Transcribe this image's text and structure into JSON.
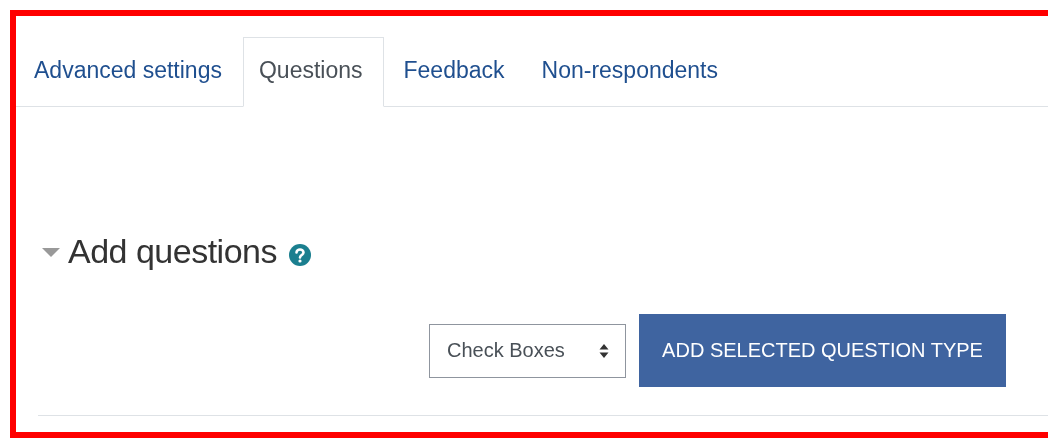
{
  "tabs": [
    {
      "label": "Advanced settings",
      "selected": false
    },
    {
      "label": "Questions",
      "selected": true
    },
    {
      "label": "Feedback",
      "selected": false
    },
    {
      "label": "Non-respondents",
      "selected": false
    }
  ],
  "section": {
    "title": "Add questions",
    "expanded": true
  },
  "question_type_select": {
    "value": "Check Boxes"
  },
  "add_button": {
    "label": "ADD SELECTED QUESTION TYPE"
  }
}
